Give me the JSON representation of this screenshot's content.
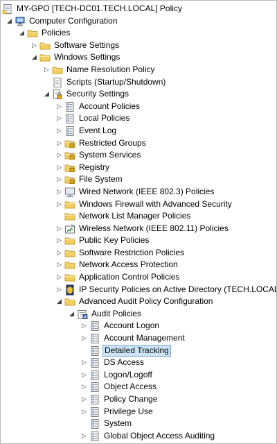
{
  "window": {
    "root_label": "MY-GPO [TECH-DC01.TECH.LOCAL] Policy",
    "selected_item": "Detailed Tracking"
  },
  "tree": [
    {
      "label": "MY-GPO [TECH-DC01.TECH.LOCAL] Policy",
      "level": 0,
      "toggle": "none",
      "icon": "policy-doc-icon"
    },
    {
      "label": "Computer Configuration",
      "level": 1,
      "toggle": "expanded",
      "icon": "computer-icon"
    },
    {
      "label": "Policies",
      "level": 2,
      "toggle": "expanded",
      "icon": "folder-icon"
    },
    {
      "label": "Software Settings",
      "level": 3,
      "toggle": "collapsed",
      "icon": "folder-icon"
    },
    {
      "label": "Windows Settings",
      "level": 3,
      "toggle": "expanded",
      "icon": "folder-icon"
    },
    {
      "label": "Name Resolution Policy",
      "level": 4,
      "toggle": "collapsed",
      "icon": "folder-icon"
    },
    {
      "label": "Scripts (Startup/Shutdown)",
      "level": 4,
      "toggle": "none",
      "icon": "script-icon"
    },
    {
      "label": "Security Settings",
      "level": 4,
      "toggle": "expanded",
      "icon": "security-icon"
    },
    {
      "label": "Account Policies",
      "level": 5,
      "toggle": "collapsed",
      "icon": "policy-list-icon"
    },
    {
      "label": "Local Policies",
      "level": 5,
      "toggle": "collapsed",
      "icon": "policy-list-icon"
    },
    {
      "label": "Event Log",
      "level": 5,
      "toggle": "collapsed",
      "icon": "policy-list-icon"
    },
    {
      "label": "Restricted Groups",
      "level": 5,
      "toggle": "collapsed",
      "icon": "lock-folder-icon"
    },
    {
      "label": "System Services",
      "level": 5,
      "toggle": "collapsed",
      "icon": "lock-folder-icon"
    },
    {
      "label": "Registry",
      "level": 5,
      "toggle": "collapsed",
      "icon": "lock-folder-icon"
    },
    {
      "label": "File System",
      "level": 5,
      "toggle": "collapsed",
      "icon": "lock-folder-icon"
    },
    {
      "label": "Wired Network (IEEE 802.3) Policies",
      "level": 5,
      "toggle": "collapsed",
      "icon": "wired-network-icon"
    },
    {
      "label": "Windows Firewall with Advanced Security",
      "level": 5,
      "toggle": "collapsed",
      "icon": "folder-icon"
    },
    {
      "label": "Network List Manager Policies",
      "level": 5,
      "toggle": "none",
      "icon": "folder-icon"
    },
    {
      "label": "Wireless Network (IEEE 802.11) Policies",
      "level": 5,
      "toggle": "collapsed",
      "icon": "wireless-network-icon"
    },
    {
      "label": "Public Key Policies",
      "level": 5,
      "toggle": "collapsed",
      "icon": "folder-icon"
    },
    {
      "label": "Software Restriction Policies",
      "level": 5,
      "toggle": "collapsed",
      "icon": "folder-icon"
    },
    {
      "label": "Network Access Protection",
      "level": 5,
      "toggle": "collapsed",
      "icon": "folder-icon"
    },
    {
      "label": "Application Control Policies",
      "level": 5,
      "toggle": "collapsed",
      "icon": "folder-icon"
    },
    {
      "label": "IP Security Policies on Active Directory (TECH.LOCAL)",
      "level": 5,
      "toggle": "collapsed",
      "icon": "ip-security-icon"
    },
    {
      "label": "Advanced Audit Policy Configuration",
      "level": 5,
      "toggle": "expanded",
      "icon": "folder-icon"
    },
    {
      "label": "Audit Policies",
      "level": 6,
      "toggle": "expanded",
      "icon": "audit-icon"
    },
    {
      "label": "Account Logon",
      "level": 7,
      "toggle": "collapsed",
      "icon": "policy-list-icon"
    },
    {
      "label": "Account Management",
      "level": 7,
      "toggle": "collapsed",
      "icon": "policy-list-icon"
    },
    {
      "label": "Detailed Tracking",
      "level": 7,
      "toggle": "none",
      "icon": "policy-list-icon",
      "selected": true
    },
    {
      "label": "DS Access",
      "level": 7,
      "toggle": "collapsed",
      "icon": "policy-list-icon"
    },
    {
      "label": "Logon/Logoff",
      "level": 7,
      "toggle": "collapsed",
      "icon": "policy-list-icon"
    },
    {
      "label": "Object Access",
      "level": 7,
      "toggle": "collapsed",
      "icon": "policy-list-icon"
    },
    {
      "label": "Policy Change",
      "level": 7,
      "toggle": "collapsed",
      "icon": "policy-list-icon"
    },
    {
      "label": "Privilege Use",
      "level": 7,
      "toggle": "collapsed",
      "icon": "policy-list-icon"
    },
    {
      "label": "System",
      "level": 7,
      "toggle": "none",
      "icon": "policy-list-icon"
    },
    {
      "label": "Global Object Access Auditing",
      "level": 7,
      "toggle": "collapsed",
      "icon": "policy-list-icon"
    }
  ],
  "colors": {
    "folder": "#f3cf61",
    "folder_edge": "#c9a230",
    "selection_bg": "#cce4f7",
    "selection_border": "#7da2ce",
    "lock": "#e0a91a"
  }
}
